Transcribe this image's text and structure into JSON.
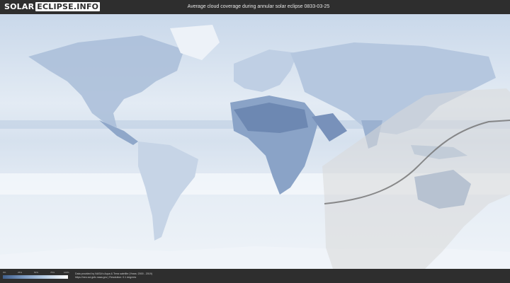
{
  "header": {
    "brand_left": "SOLAR",
    "brand_right": "ECLIPSE.INFO",
    "title": "Average cloud coverage during annular solar eclipse 0833-03-25"
  },
  "legend": {
    "ticks": [
      "0%",
      "25%",
      "50%",
      "75%",
      "100%"
    ],
    "credit_line1": "Data provided by NASA's Aqua & Terra satellite (Years: 2000 - 2019)",
    "credit_line2": "https://neo.sci.gsfc.nasa.gov  |  Resolution: 0.1 degrees"
  },
  "colors": {
    "ocean": "#dfe8f2",
    "land_clear": "#7b94b8",
    "cloud": "#f4f7fb",
    "eclipse_zone": "#d9d9d9",
    "central_line": "#707070"
  }
}
